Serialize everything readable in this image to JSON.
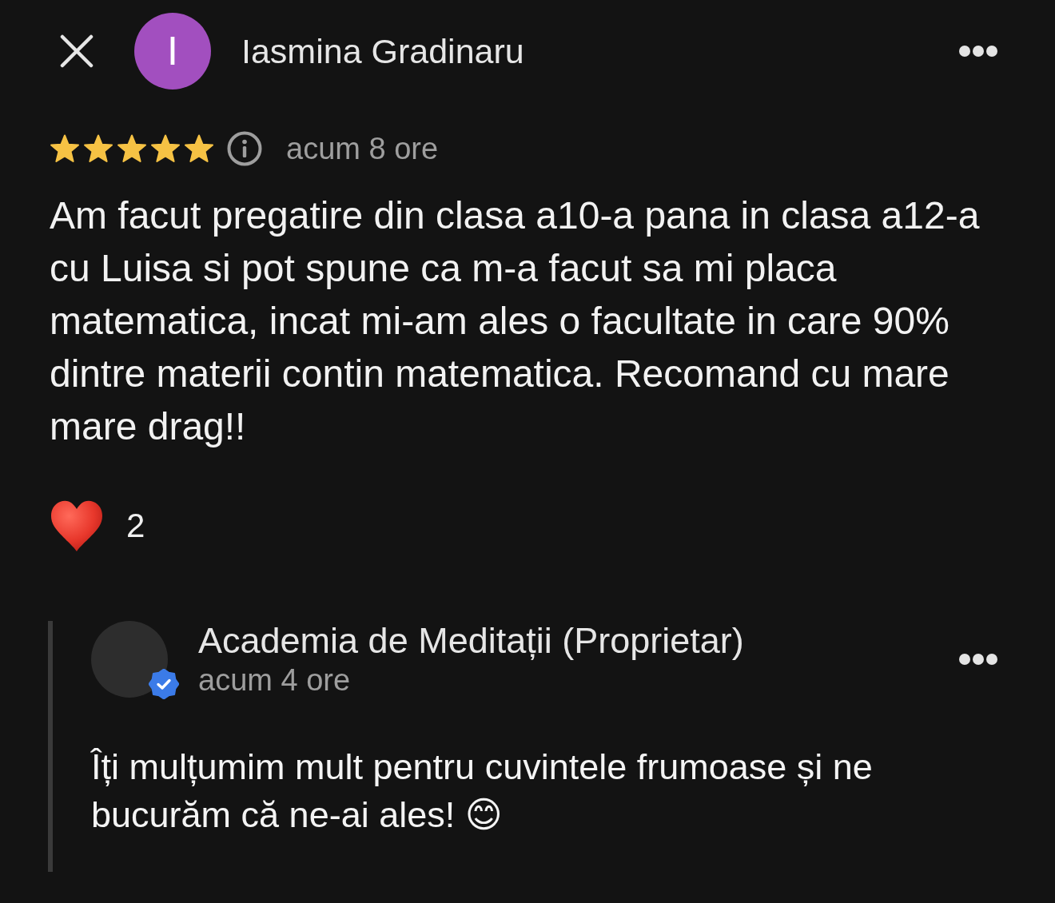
{
  "review": {
    "author": {
      "initial": "I",
      "name": "Iasmina Gradinaru"
    },
    "stars": 5,
    "time": "acum 8 ore",
    "text": "Am facut pregatire din clasa a10-a pana in clasa a12-a cu Luisa si pot spune ca m-a facut sa mi placa matematica, incat mi-am ales o facultate in care 90% dintre materii contin matematica. Recomand cu mare mare drag!!",
    "reactions": [
      {
        "kind": "heart",
        "count": "2"
      }
    ]
  },
  "reply": {
    "author": "Academia de Meditații (Proprietar)",
    "verified": true,
    "time": "acum 4 ore",
    "text": "Îți mulțumim mult pentru cuvintele frumoase și ne bucurăm că ne-ai ales! 😊"
  }
}
